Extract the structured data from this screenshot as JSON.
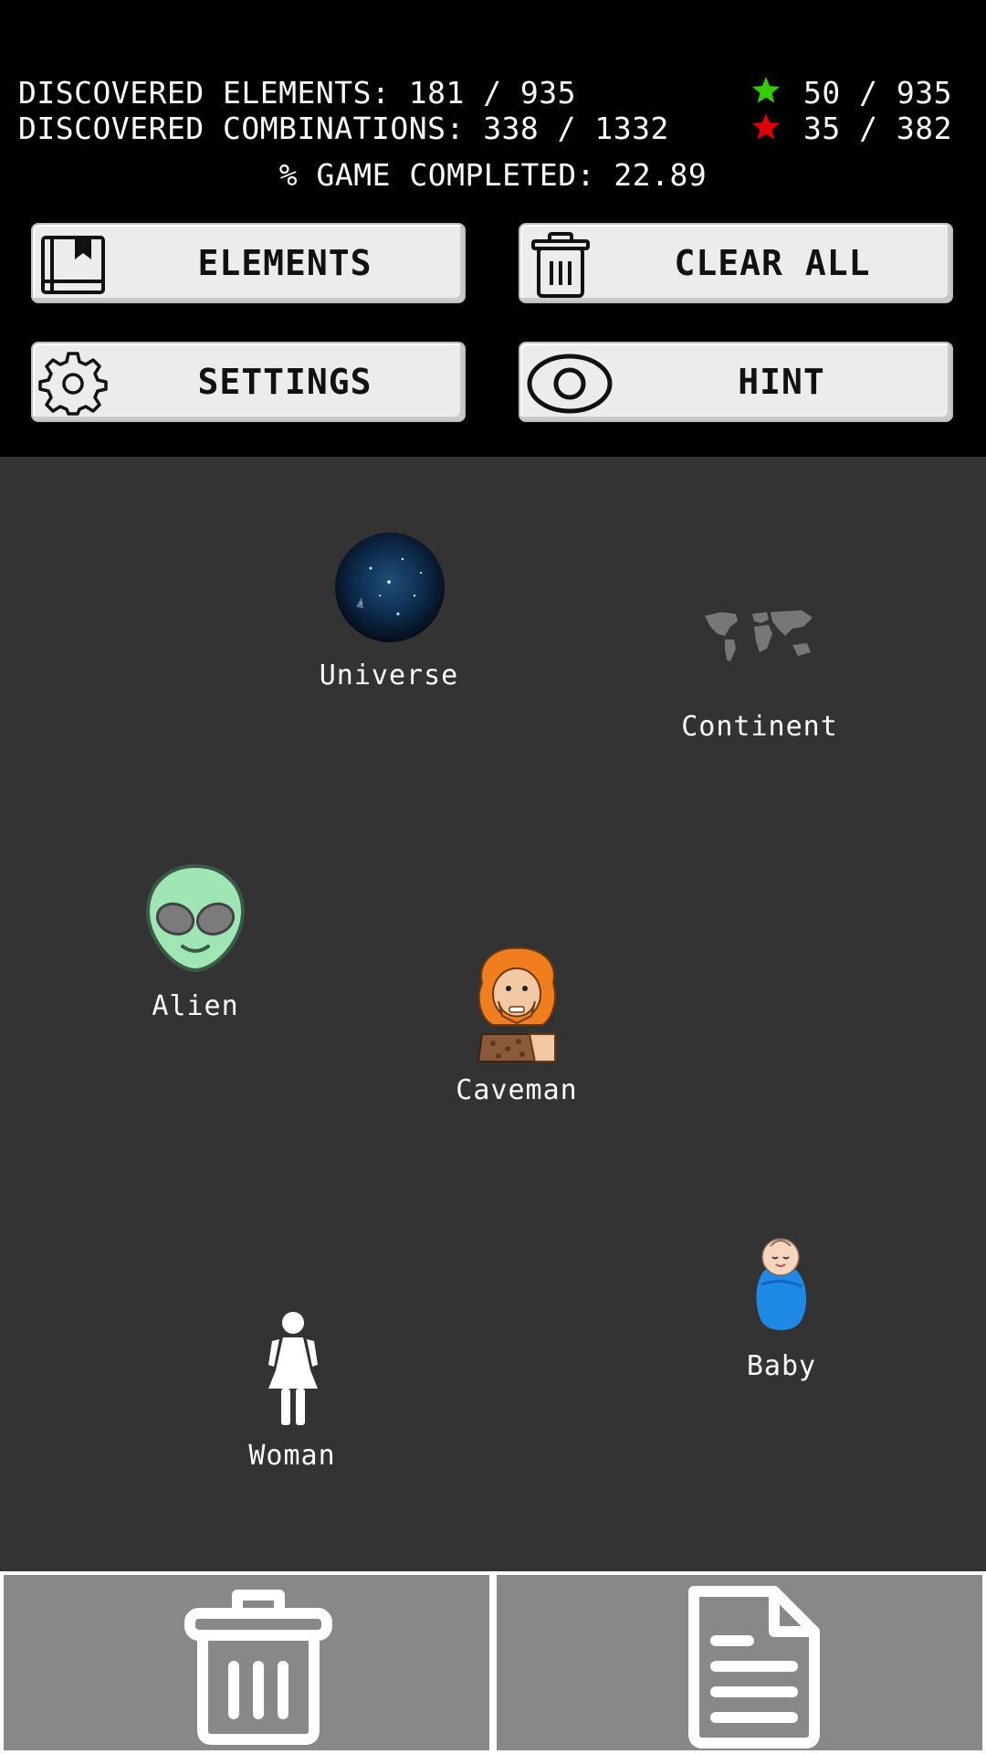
{
  "stats": {
    "elements_line": "DISCOVERED ELEMENTS: 181 / 935",
    "combinations_line": "DISCOVERED COMBINATIONS: 338 / 1332",
    "green_star_count": "50 / 935",
    "red_star_count": "35 / 382",
    "completion_line": "% GAME COMPLETED: 22.89"
  },
  "buttons": {
    "elements": "ELEMENTS",
    "clear_all": "CLEAR ALL",
    "settings": "SETTINGS",
    "hint": "HINT"
  },
  "board": {
    "items": [
      {
        "label": "Universe",
        "icon": "universe-icon"
      },
      {
        "label": "Continent",
        "icon": "world-map-icon"
      },
      {
        "label": "Alien",
        "icon": "alien-icon"
      },
      {
        "label": "Caveman",
        "icon": "caveman-icon"
      },
      {
        "label": "Baby",
        "icon": "baby-icon"
      },
      {
        "label": "Woman",
        "icon": "woman-icon"
      }
    ]
  },
  "colors": {
    "header_bg": "#000000",
    "board_bg": "#333333",
    "bottom_bar_bg": "#888888",
    "green_star": "#33cc00",
    "red_star": "#e00000"
  }
}
